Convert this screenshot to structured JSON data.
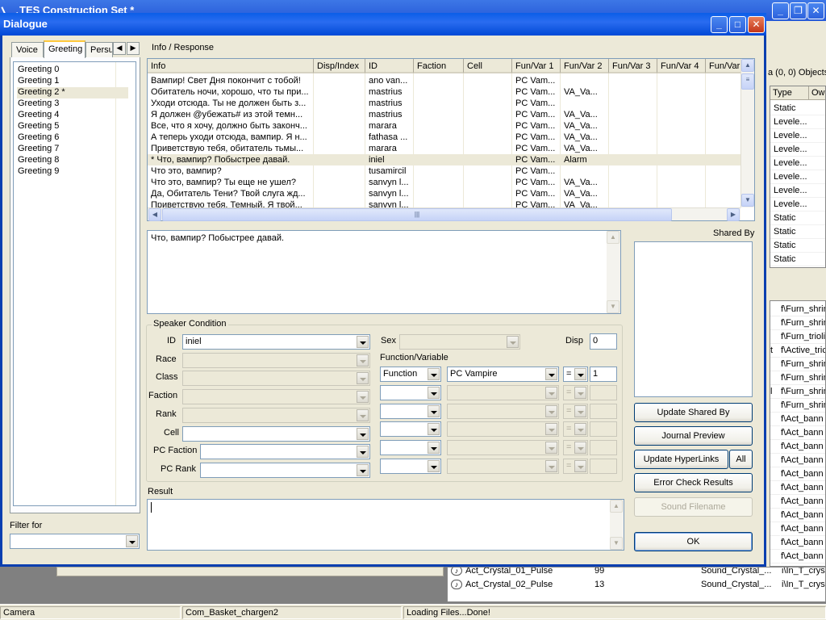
{
  "app": {
    "title": "TES Construction Set *",
    "objects_label": "a (0, 0) Objects",
    "type_header": "Type",
    "ow_header": "Ow",
    "type_values": [
      "Static",
      "Levele...",
      "Levele...",
      "Levele...",
      "Levele...",
      "Levele...",
      "Levele...",
      "Levele...",
      "Static",
      "Static",
      "Static",
      "Static"
    ],
    "right_list": [
      {
        "pre": "",
        "name": "f\\Furn_shrin"
      },
      {
        "pre": "",
        "name": "f\\Furn_shrin"
      },
      {
        "pre": "",
        "name": "f\\Furn_triolit"
      },
      {
        "pre": "t",
        "name": "f\\Active_tric"
      },
      {
        "pre": "",
        "name": "f\\Furn_shrin"
      },
      {
        "pre": "",
        "name": "f\\Furn_shrin"
      },
      {
        "pre": "l",
        "name": "f\\Furn_shrin"
      },
      {
        "pre": "",
        "name": "f\\Furn_shrin"
      },
      {
        "pre": "",
        "name": "f\\Act_bann"
      },
      {
        "pre": "",
        "name": "f\\Act_bann"
      },
      {
        "pre": "",
        "name": "f\\Act_bann"
      },
      {
        "pre": "",
        "name": "f\\Act_bann"
      },
      {
        "pre": "",
        "name": "f\\Act_bann"
      },
      {
        "pre": "",
        "name": "f\\Act_bann"
      },
      {
        "pre": "",
        "name": "f\\Act_bann"
      },
      {
        "pre": "",
        "name": "f\\Act_bann"
      },
      {
        "pre": "",
        "name": "f\\Act_bann"
      },
      {
        "pre": "",
        "name": "f\\Act_bann"
      },
      {
        "pre": "",
        "name": "f\\Act_bann"
      }
    ],
    "bottom_list": [
      {
        "name": "Act_Crystal_01_Pulse",
        "count": "99",
        "type": "Sound_Crystal_...",
        "path": "i\\In_T_crys"
      },
      {
        "name": "Act_Crystal_02_Pulse",
        "count": "13",
        "type": "Sound_Crystal_...",
        "path": "i\\In_T_crys"
      }
    ],
    "status": [
      "Camera",
      "Com_Basket_chargen2",
      "Loading Files...Done!"
    ]
  },
  "dialog": {
    "title": "Dialogue",
    "tabs": [
      "Voice",
      "Greeting",
      "Persu"
    ],
    "greetings": [
      "Greeting 0",
      "Greeting 1",
      "Greeting 2 *",
      "Greeting 3",
      "Greeting 4",
      "Greeting 5",
      "Greeting 6",
      "Greeting 7",
      "Greeting 8",
      "Greeting 9"
    ],
    "filter_label": "Filter for",
    "filter_value": "",
    "info_response_label": "Info / Response",
    "columns": [
      "Info",
      "Disp/Index",
      "ID",
      "Faction",
      "Cell",
      "Fun/Var 1",
      "Fun/Var 2",
      "Fun/Var 3",
      "Fun/Var 4",
      "Fun/Var"
    ],
    "rows": [
      [
        "Вампир! Свет Дня покончит с тобой!",
        "",
        "ano van...",
        "",
        "",
        "PC Vam...",
        "",
        "",
        "",
        ""
      ],
      [
        "Обитатель ночи, хорошо, что ты при...",
        "",
        "mastrius",
        "",
        "",
        "PC Vam...",
        "VA_Va...",
        "",
        "",
        ""
      ],
      [
        "Уходи отсюда. Ты не должен быть з...",
        "",
        "mastrius",
        "",
        "",
        "PC Vam...",
        "",
        "",
        "",
        ""
      ],
      [
        "Я должен @убежать# из этой темн...",
        "",
        "mastrius",
        "",
        "",
        "PC Vam...",
        "VA_Va...",
        "",
        "",
        ""
      ],
      [
        "Все, что я хочу, должно быть законч...",
        "",
        "marara",
        "",
        "",
        "PC Vam...",
        "VA_Va...",
        "",
        "",
        ""
      ],
      [
        "А теперь уходи отсюда, вампир. Я н...",
        "",
        "fathasa ...",
        "",
        "",
        "PC Vam...",
        "VA_Va...",
        "",
        "",
        ""
      ],
      [
        "Приветствую тебя, обитатель тьмы...",
        "",
        "marara",
        "",
        "",
        "PC Vam...",
        "VA_Va...",
        "",
        "",
        ""
      ],
      [
        "* Что, вампир? Побыстрее давай.",
        "",
        "iniel",
        "",
        "",
        "PC Vam...",
        "Alarm",
        "",
        "",
        ""
      ],
      [
        "Что это, вампир?",
        "",
        "tusamircil",
        "",
        "",
        "PC Vam...",
        "",
        "",
        "",
        ""
      ],
      [
        "Что это, вампир? Ты еще не ушел?",
        "",
        "sanvyn l...",
        "",
        "",
        "PC Vam...",
        "VA_Va...",
        "",
        "",
        ""
      ],
      [
        "Да, Обитатель Тени? Твой слуга жд...",
        "",
        "sanvyn l...",
        "",
        "",
        "PC Vam...",
        "VA_Va...",
        "",
        "",
        ""
      ],
      [
        "Приветствую тебя, Темный. Я твой...",
        "",
        "sanvyn l...",
        "",
        "",
        "PC Vam...",
        "VA_Va...",
        "",
        "",
        ""
      ]
    ],
    "response_text": "Что, вампир? Побыстрее давай.",
    "shared_by_label": "Shared By",
    "speaker_condition": {
      "title": "Speaker Condition",
      "id_label": "ID",
      "id_value": "iniel",
      "race_label": "Race",
      "class_label": "Class",
      "faction_label": "Faction",
      "rank_label": "Rank",
      "cell_label": "Cell",
      "pc_faction_label": "PC Faction",
      "pc_rank_label": "PC Rank",
      "sex_label": "Sex",
      "disp_label": "Disp",
      "disp_value": "0",
      "funcvar_label": "Function/Variable",
      "func_type": "Function",
      "func_name": "PC Vampire",
      "func_op": "=",
      "func_value": "1",
      "disabled_op": "="
    },
    "result_label": "Result",
    "result_text": "",
    "buttons": {
      "update_shared_by": "Update Shared By",
      "journal_preview": "Journal Preview",
      "update_hyperlinks": "Update HyperLinks",
      "all": "All",
      "error_check": "Error Check Results",
      "sound_filename": "Sound Filename",
      "ok": "OK"
    }
  }
}
